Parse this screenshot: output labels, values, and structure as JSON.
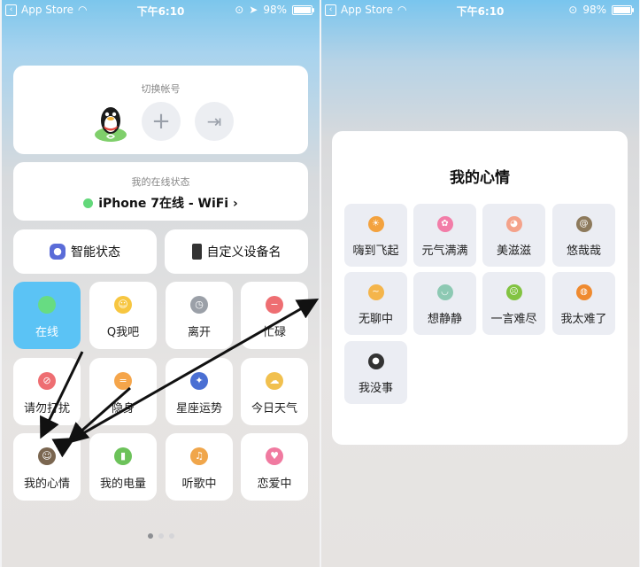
{
  "status_bar": {
    "back_label": "App Store",
    "time": "下午6:10",
    "battery": "98%",
    "battery_level": 0.98
  },
  "left": {
    "accounts": {
      "title": "切换帐号",
      "add_symbol": "+",
      "logout_symbol": "⇥"
    },
    "online_status": {
      "title": "我的在线状态",
      "value": "iPhone 7在线 - WiFi",
      "chevron": "›"
    },
    "smart_status_label": "智能状态",
    "custom_device_label": "自定义设备名",
    "tiles": [
      {
        "label": "在线",
        "icon": "green-dot-icon",
        "icon_char": "",
        "color": "#67dc82"
      },
      {
        "label": "Q我吧",
        "icon": "smile-face-icon",
        "icon_char": "☺",
        "color": "#f7c640"
      },
      {
        "label": "离开",
        "icon": "clock-icon",
        "icon_char": "◷",
        "color": "#9ba0a8"
      },
      {
        "label": "忙碌",
        "icon": "busy-minus-icon",
        "icon_char": "−",
        "color": "#ee6e72"
      },
      {
        "label": "请勿打扰",
        "icon": "no-disturb-icon",
        "icon_char": "⊘",
        "color": "#ee6e72"
      },
      {
        "label": "隐身",
        "icon": "hidden-icon",
        "icon_char": "=",
        "color": "#f5a54a"
      },
      {
        "label": "星座运势",
        "icon": "zodiac-icon",
        "icon_char": "✦",
        "color": "#4a6fd3"
      },
      {
        "label": "今日天气",
        "icon": "weather-icon",
        "icon_char": "☁",
        "color": "#f1c04e"
      },
      {
        "label": "我的心情",
        "icon": "mood-icon",
        "icon_char": "☺",
        "color": "#7a6650"
      },
      {
        "label": "我的电量",
        "icon": "battery-icon",
        "icon_char": "▮",
        "color": "#6cc25a"
      },
      {
        "label": "听歌中",
        "icon": "headphones-icon",
        "icon_char": "♫",
        "color": "#f0a64b"
      },
      {
        "label": "恋爱中",
        "icon": "love-icon",
        "icon_char": "♥",
        "color": "#f07aa0"
      }
    ],
    "page_count": 3,
    "active_page": 1
  },
  "right": {
    "title": "我的心情",
    "moods": [
      {
        "label": "嗨到飞起",
        "icon": "sun-flower-icon",
        "icon_char": "☀",
        "color": "#f3a23e"
      },
      {
        "label": "元气满满",
        "icon": "pink-flower-icon",
        "icon_char": "✿",
        "color": "#f27da8"
      },
      {
        "label": "美滋滋",
        "icon": "peach-icon",
        "icon_char": "◕",
        "color": "#f4a28a"
      },
      {
        "label": "悠哉哉",
        "icon": "snail-icon",
        "icon_char": "@",
        "color": "#8d7a5c"
      },
      {
        "label": "无聊中",
        "icon": "bored-icon",
        "icon_char": "~",
        "color": "#f4b54b"
      },
      {
        "label": "想静静",
        "icon": "calm-icon",
        "icon_char": "◡",
        "color": "#8dc9b3"
      },
      {
        "label": "一言难尽",
        "icon": "speechless-icon",
        "icon_char": "☹",
        "color": "#82c341"
      },
      {
        "label": "我太难了",
        "icon": "pumpkin-icon",
        "icon_char": "◍",
        "color": "#ef8a2f"
      },
      {
        "label": "我没事",
        "icon": "bomb-icon",
        "icon_char": "●",
        "color": "#333333"
      }
    ]
  }
}
